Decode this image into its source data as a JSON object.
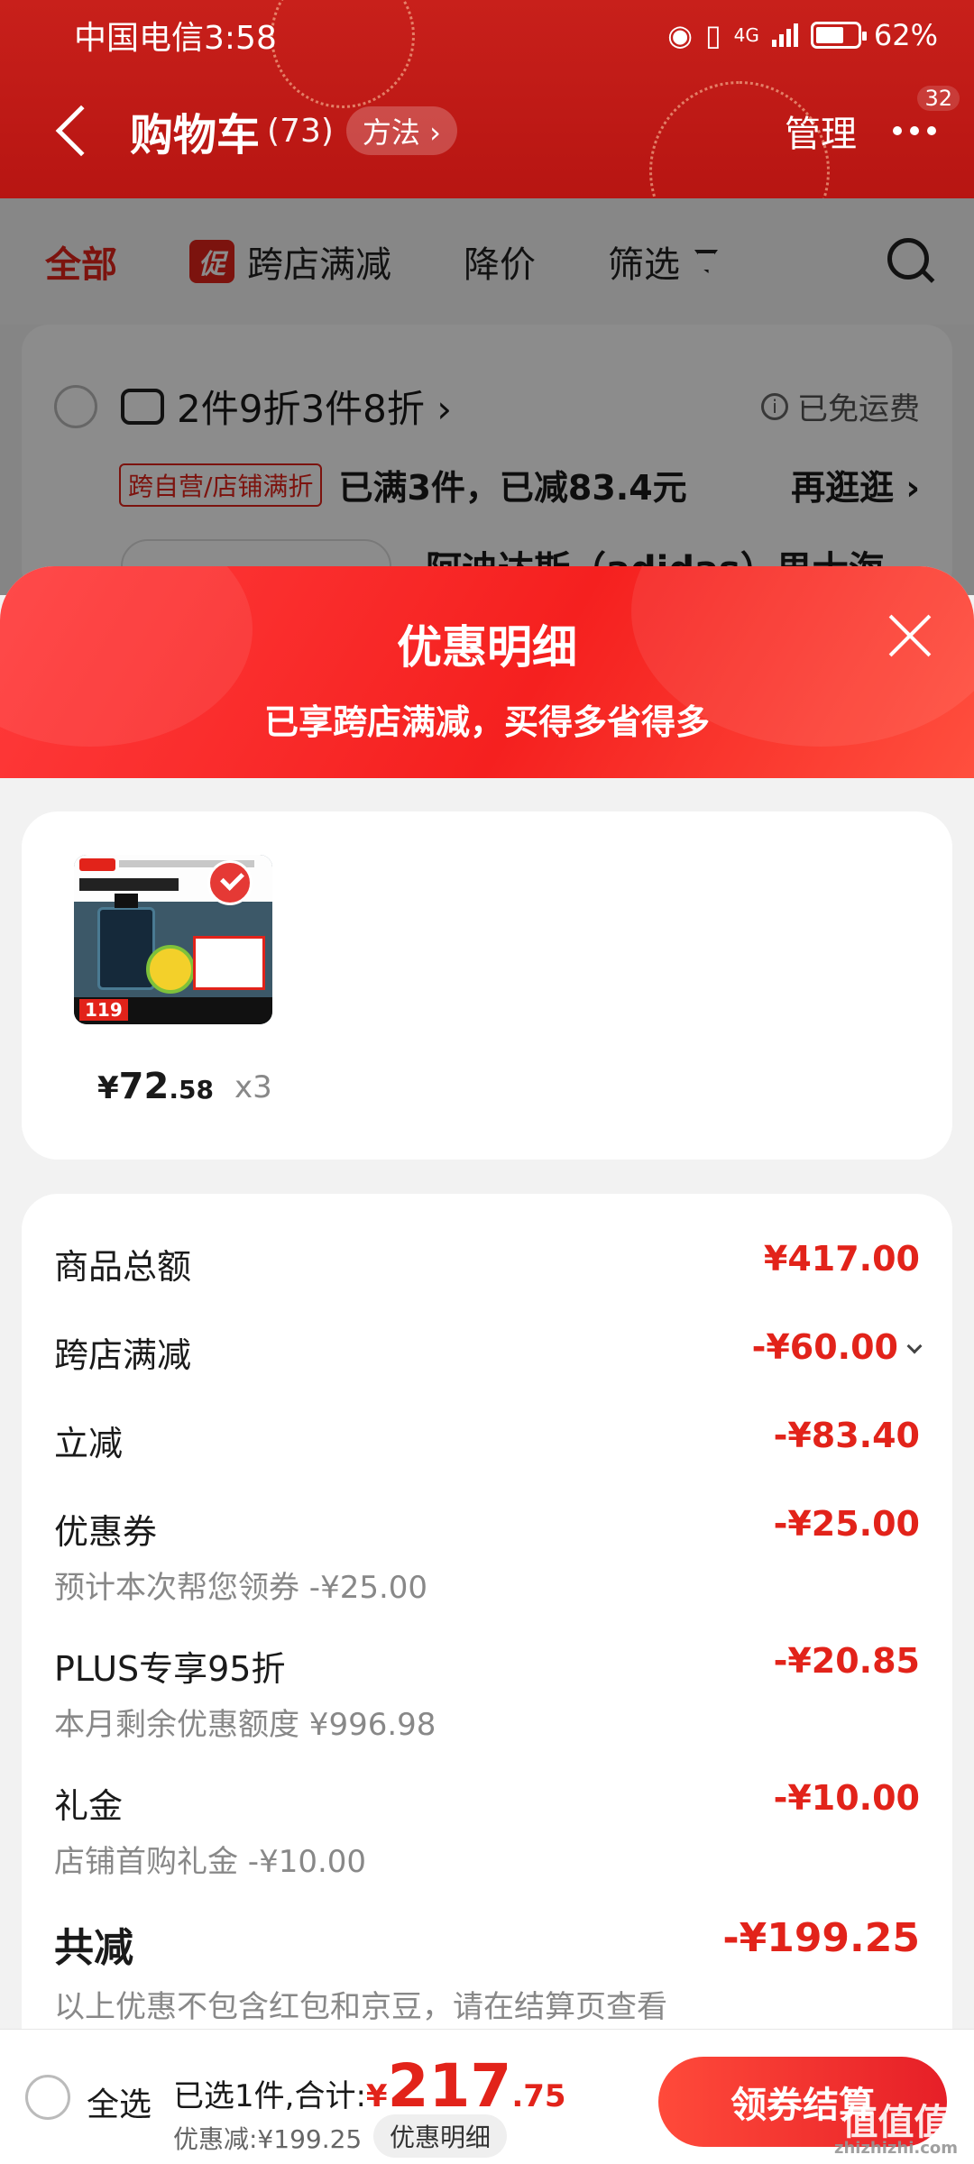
{
  "status_bar": {
    "carrier_time": "中国电信3:58",
    "network": "4G",
    "battery": "62%"
  },
  "header": {
    "title": "购物车",
    "count": "(73)",
    "method_label": "方法 ›",
    "manage_label": "管理",
    "message_badge": "32"
  },
  "tabs": [
    {
      "label": "全部"
    },
    {
      "badge": "促",
      "label": "跨店满减"
    },
    {
      "label": "降价"
    },
    {
      "label": "筛选"
    }
  ],
  "shop_card": {
    "promo_text": "2件9折3件8折 ›",
    "free_shipping": "已免运费",
    "tag": "跨自营/店铺满折",
    "status": "已满3件，已减83.4元",
    "browse_label": "再逛逛 ›",
    "shop_name": "阿迪达斯（adidas）男士海"
  },
  "sheet": {
    "title": "优惠明细",
    "subtitle": "已享跨店满减，买得多省得多",
    "product": {
      "image_price_tag": "119",
      "price_symbol": "¥",
      "price_int": "72",
      "price_dec": ".58",
      "quantity": "x3"
    },
    "details": [
      {
        "label": "商品总额",
        "value": "¥417.00",
        "sub": ""
      },
      {
        "label": "跨店满减",
        "value": "-¥60.00",
        "sub": ""
      },
      {
        "label": "立减",
        "value": "-¥83.40",
        "sub": ""
      },
      {
        "label": "优惠券",
        "value": "-¥25.00",
        "sub": "预计本次帮您领券 -¥25.00"
      },
      {
        "label": "PLUS专享95折",
        "value": "-¥20.85",
        "sub": "本月剩余优惠额度 ¥996.98"
      },
      {
        "label": "礼金",
        "value": "-¥10.00",
        "sub": "店铺首购礼金 -¥10.00"
      }
    ],
    "total": {
      "label": "共减",
      "value": "-¥199.25",
      "note": "以上优惠不包含红包和京豆，请在结算页查看"
    }
  },
  "bottom_bar": {
    "select_all": "全选",
    "summary_prefix": "已选1件,合计:",
    "yen": "¥",
    "total_int": "217",
    "total_dec": ".75",
    "discount": "优惠减:¥199.25",
    "detail_button": "优惠明细",
    "checkout_button": "领券结算"
  },
  "watermark": {
    "mark": "值值值",
    "url": "zhizhizhi.com"
  },
  "colors": {
    "brand_red": "#e2231a",
    "header_red": "#c8201b",
    "sheet_gradient_start": "#ff3b3b",
    "sheet_gradient_end": "#f5201f"
  }
}
